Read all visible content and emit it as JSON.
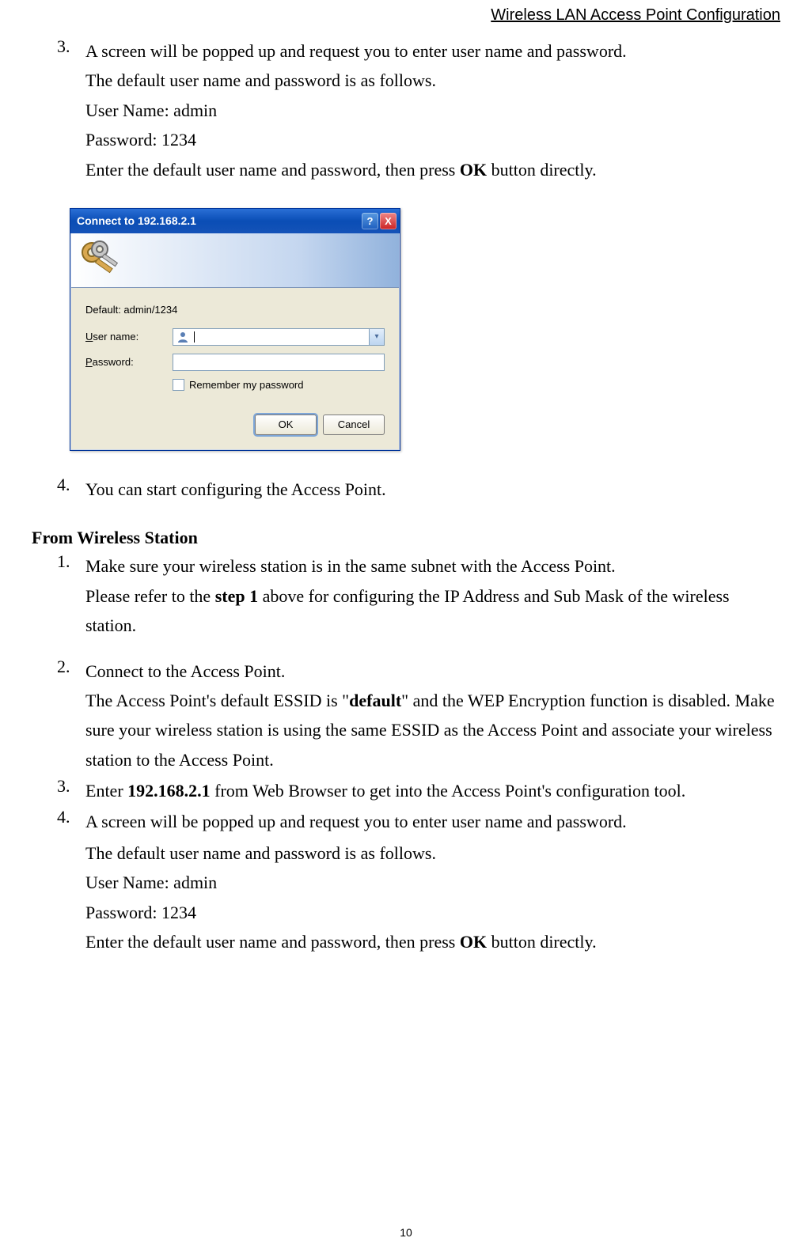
{
  "header": "Wireless LAN Access Point Configuration",
  "top": {
    "item3_num": "3.",
    "item3_line1": "A screen will be popped up and request you to enter user name and password.",
    "item3_line2": "The default user name and password is as follows.",
    "item3_line3": "User Name: admin",
    "item3_line4": "Password: 1234",
    "item3_line5a": "Enter the default user name and password, then press ",
    "item3_line5b": "OK",
    "item3_line5c": " button directly."
  },
  "dialog": {
    "title": "Connect to 192.168.2.1",
    "help": "?",
    "close": "X",
    "realm": "Default: admin/1234",
    "user_label_pre": "U",
    "user_label_rest": "ser name:",
    "pass_label_pre": "P",
    "pass_label_rest": "assword:",
    "remember_pre": "R",
    "remember_rest": "emember my password",
    "ok": "OK",
    "cancel": "Cancel"
  },
  "mid": {
    "item4_num": "4.",
    "item4_text": "You can start configuring the Access Point."
  },
  "sec": {
    "heading": "From Wireless Station",
    "s1_num": "1.",
    "s1_a": "Make sure your wireless station is in the same subnet with the Access Point.",
    "s1_b1": "Please refer to the ",
    "s1_b2": "step 1",
    "s1_b3": " above for configuring the IP Address and Sub Mask of the wireless station.",
    "s2_num": "2.",
    "s2_a": "Connect to the Access Point.",
    "s2_b1": "The Access Point's default ESSID is \"",
    "s2_b2": "default",
    "s2_b3": "\" and the WEP Encryption function is disabled. Make sure your wireless station is using the same ESSID as the Access Point and associate your wireless station to the Access Point.",
    "s3_num": "3.",
    "s3_a1": "Enter ",
    "s3_a2": "192.168.2.1",
    "s3_a3": " from Web Browser to get into the Access Point's configuration tool.",
    "s4_num": "4.",
    "s4_a": "A screen will be popped up and request you to enter user name and password.",
    "s4_b": "The default user name and password is as follows.",
    "s4_c": "User Name: admin",
    "s4_d": "Password: 1234",
    "s4_e1": "Enter the default user name and password, then press ",
    "s4_e2": "OK",
    "s4_e3": " button directly."
  },
  "page_number": "10"
}
